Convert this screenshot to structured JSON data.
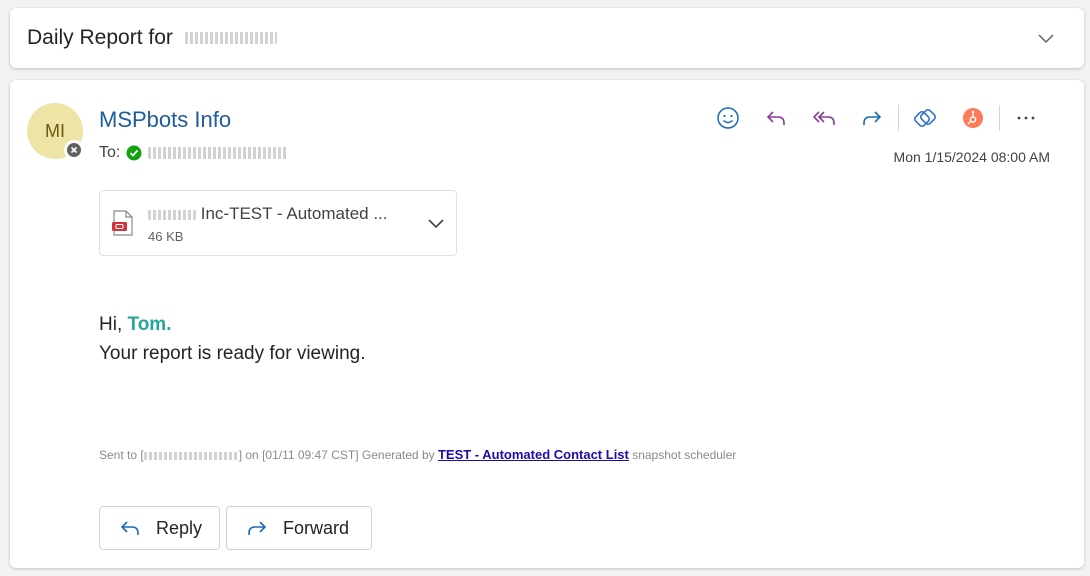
{
  "subject": {
    "title": "Daily Report for"
  },
  "message": {
    "avatar_initials": "MI",
    "sender": "MSPbots Info",
    "to_label": "To:",
    "date": "Mon 1/15/2024 08:00 AM",
    "attachment": {
      "name": "Inc-TEST - Automated ...",
      "size": "46 KB"
    },
    "greeting": "Hi, ",
    "recipient_name": "Tom.",
    "body_line": "Your report is ready for viewing.",
    "footer": {
      "sent_to": "Sent to [",
      "sent_close": "]",
      "on_text": " on [01/11 09:47 CST] Generated by ",
      "link_text": "TEST - Automated Contact List",
      "suffix": " snapshot scheduler"
    }
  },
  "actions": {
    "reply_label": "Reply",
    "forward_label": "Forward"
  },
  "colors": {
    "sender": "#1f5c9c",
    "accent_purple": "#8b3a96",
    "accent_blue": "#1a6bb8",
    "hubspot": "#ff7a59",
    "highlight": "#26a69a"
  }
}
